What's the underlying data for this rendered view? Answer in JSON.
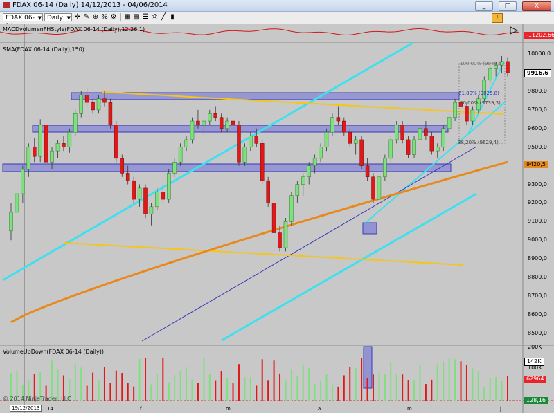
{
  "window": {
    "title": "FDAX 06-14 (Daily)  14/12/2013 - 04/06/2014",
    "buttons": [
      "_",
      "□",
      "X"
    ]
  },
  "toolbar": {
    "symbol": "FDAX 06-14",
    "interval": "Daily",
    "icons": [
      "crosshair-icon",
      "pencil-icon",
      "zoom-icon",
      "percent-icon",
      "gear-icon",
      "grid-icon",
      "data-box-icon",
      "properties-icon",
      "print-icon",
      "line-icon",
      "bars-icon"
    ],
    "right_icon": "alert-icon"
  },
  "panels": {
    "macd": {
      "label": "MACDvolumenFHStyle(FDAX 06-14 (Daily),12,26,1)",
      "value": "-11202,66",
      "value_color": "#e8232a"
    },
    "price": {
      "label": "SMA(FDAX 06-14 (Daily),150)",
      "last_price": "9916,6",
      "sma_value": "9420,5",
      "sma_color": "#e8891c",
      "fib_labels": [
        "100,00% (9949,5)",
        "61,80% (9825,8)",
        "50,00% (9739,3)",
        "38,20% (9629,4)"
      ],
      "y_axis": [
        "10000,0",
        "9900,0",
        "9800,0",
        "9700,0",
        "9600,0",
        "9500,0",
        "9400,0",
        "9300,0",
        "9200,0",
        "9100,0",
        "9000,0",
        "8900,0",
        "8800,0",
        "8700,0",
        "8600,0",
        "8500,0"
      ]
    },
    "volume": {
      "label": "VolumeUpDown(FDAX 06-14 (Daily))",
      "axis": [
        "200K",
        "142K",
        "100K",
        "62964"
      ],
      "axis_last": "62964"
    },
    "bottom": {
      "label": "© 2014 NinjaTrader, LLC",
      "value": "128,16",
      "value_color": "#1a8a3a"
    }
  },
  "x_axis": {
    "labels": [
      "19/12/2013",
      "14",
      "f",
      "m",
      "a",
      "m",
      "j"
    ],
    "cursor_date": "19/12/2013"
  },
  "chart_data": {
    "type": "candlestick",
    "title": "FDAX 06-14 (Daily)",
    "ylim": [
      8440,
      10060
    ],
    "series": [
      {
        "name": "SMA(150)",
        "values": "moving-average line rising from ~8560 to 9420,5"
      }
    ],
    "candles": [
      [
        9050,
        9200,
        9000,
        9150
      ],
      [
        9150,
        9300,
        9100,
        9250
      ],
      [
        9250,
        9400,
        9200,
        9380
      ],
      [
        9380,
        9520,
        9340,
        9500
      ],
      [
        9500,
        9550,
        9420,
        9450
      ],
      [
        9450,
        9650,
        9420,
        9620
      ],
      [
        9620,
        9640,
        9380,
        9420
      ],
      [
        9420,
        9500,
        9380,
        9480
      ],
      [
        9480,
        9540,
        9440,
        9520
      ],
      [
        9520,
        9560,
        9480,
        9500
      ],
      [
        9500,
        9600,
        9470,
        9580
      ],
      [
        9580,
        9700,
        9560,
        9680
      ],
      [
        9680,
        9800,
        9660,
        9780
      ],
      [
        9780,
        9820,
        9720,
        9740
      ],
      [
        9740,
        9760,
        9680,
        9700
      ],
      [
        9700,
        9780,
        9680,
        9760
      ],
      [
        9760,
        9800,
        9720,
        9740
      ],
      [
        9740,
        9760,
        9600,
        9620
      ],
      [
        9620,
        9640,
        9420,
        9440
      ],
      [
        9440,
        9460,
        9340,
        9360
      ],
      [
        9360,
        9400,
        9300,
        9320
      ],
      [
        9320,
        9340,
        9200,
        9220
      ],
      [
        9220,
        9300,
        9180,
        9280
      ],
      [
        9280,
        9300,
        9120,
        9140
      ],
      [
        9140,
        9200,
        9080,
        9180
      ],
      [
        9180,
        9280,
        9160,
        9260
      ],
      [
        9260,
        9300,
        9200,
        9220
      ],
      [
        9220,
        9380,
        9200,
        9360
      ],
      [
        9360,
        9440,
        9340,
        9420
      ],
      [
        9420,
        9520,
        9400,
        9500
      ],
      [
        9500,
        9560,
        9480,
        9540
      ],
      [
        9540,
        9660,
        9520,
        9640
      ],
      [
        9640,
        9700,
        9600,
        9620
      ],
      [
        9620,
        9660,
        9560,
        9640
      ],
      [
        9640,
        9700,
        9620,
        9680
      ],
      [
        9680,
        9720,
        9640,
        9660
      ],
      [
        9660,
        9680,
        9580,
        9600
      ],
      [
        9600,
        9660,
        9580,
        9640
      ],
      [
        9640,
        9680,
        9600,
        9620
      ],
      [
        9620,
        9640,
        9400,
        9420
      ],
      [
        9420,
        9520,
        9400,
        9500
      ],
      [
        9500,
        9580,
        9480,
        9560
      ],
      [
        9560,
        9600,
        9500,
        9520
      ],
      [
        9520,
        9540,
        9300,
        9320
      ],
      [
        9320,
        9340,
        9180,
        9200
      ],
      [
        9200,
        9220,
        9020,
        9040
      ],
      [
        9040,
        9080,
        8940,
        8960
      ],
      [
        8960,
        9120,
        8940,
        9100
      ],
      [
        9100,
        9260,
        9080,
        9240
      ],
      [
        9240,
        9320,
        9200,
        9300
      ],
      [
        9300,
        9360,
        9240,
        9340
      ],
      [
        9340,
        9420,
        9300,
        9400
      ],
      [
        9400,
        9460,
        9360,
        9440
      ],
      [
        9440,
        9520,
        9420,
        9500
      ],
      [
        9500,
        9600,
        9480,
        9580
      ],
      [
        9580,
        9680,
        9560,
        9660
      ],
      [
        9660,
        9720,
        9620,
        9640
      ],
      [
        9640,
        9660,
        9560,
        9580
      ],
      [
        9580,
        9600,
        9500,
        9520
      ],
      [
        9520,
        9560,
        9460,
        9540
      ],
      [
        9540,
        9560,
        9380,
        9400
      ],
      [
        9400,
        9440,
        9320,
        9340
      ],
      [
        9340,
        9360,
        9200,
        9220
      ],
      [
        9220,
        9360,
        9200,
        9340
      ],
      [
        9340,
        9460,
        9320,
        9440
      ],
      [
        9440,
        9560,
        9420,
        9540
      ],
      [
        9540,
        9640,
        9520,
        9620
      ],
      [
        9620,
        9640,
        9520,
        9540
      ],
      [
        9540,
        9560,
        9440,
        9460
      ],
      [
        9460,
        9560,
        9440,
        9540
      ],
      [
        9540,
        9620,
        9520,
        9600
      ],
      [
        9600,
        9640,
        9540,
        9560
      ],
      [
        9560,
        9580,
        9460,
        9480
      ],
      [
        9480,
        9520,
        9440,
        9500
      ],
      [
        9500,
        9620,
        9480,
        9600
      ],
      [
        9600,
        9680,
        9580,
        9660
      ],
      [
        9660,
        9760,
        9640,
        9740
      ],
      [
        9740,
        9800,
        9700,
        9720
      ],
      [
        9720,
        9740,
        9620,
        9640
      ],
      [
        9640,
        9720,
        9620,
        9700
      ],
      [
        9700,
        9780,
        9680,
        9760
      ],
      [
        9760,
        9880,
        9740,
        9860
      ],
      [
        9860,
        9940,
        9840,
        9920
      ],
      [
        9920,
        9960,
        9880,
        9940
      ],
      [
        9940,
        9990,
        9900,
        9960
      ],
      [
        9960,
        9980,
        9880,
        9900
      ]
    ]
  }
}
